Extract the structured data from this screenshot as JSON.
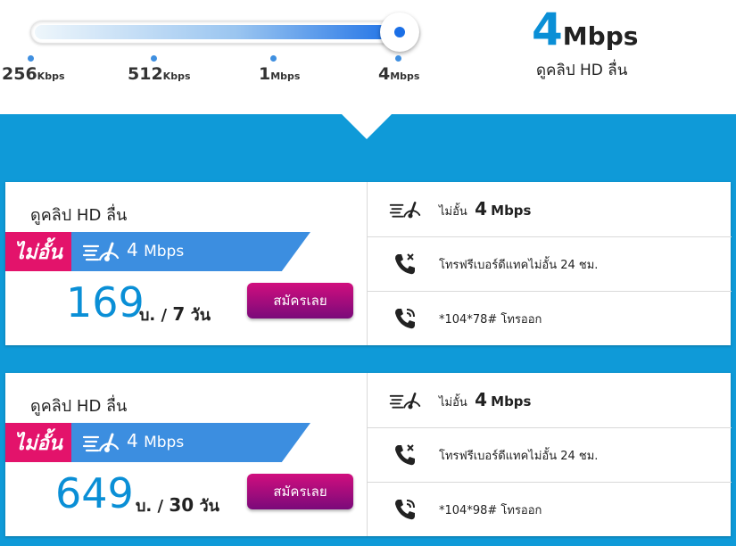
{
  "speed_selector": {
    "ticks": [
      {
        "value": "256",
        "unit": "Kbps"
      },
      {
        "value": "512",
        "unit": "Kbps"
      },
      {
        "value": "1",
        "unit": "Mbps"
      },
      {
        "value": "4",
        "unit": "Mbps"
      }
    ],
    "selected_index": 3,
    "slider_fraction": 1.0
  },
  "speed_readout": {
    "value": "4",
    "unit": "Mbps",
    "subtitle": "ดูคลิป HD ลื่น"
  },
  "plans": [
    {
      "title": "ดูคลิป HD ลื่น",
      "banner_tag": "ไม่อั้น",
      "banner_speed": "4",
      "banner_unit": "Mbps",
      "price": "169",
      "price_unit": "บ. /",
      "duration": "7",
      "duration_unit": "วัน",
      "button_label": "สมัครเลย",
      "features": {
        "speed_prefix": "ไม่อั้น",
        "speed_value": "4",
        "speed_unit": "Mbps",
        "call_text": "โทรฟรีเบอร์ดีแทคไม่อั้น 24 ชม.",
        "dial_code": "*104*78#",
        "dial_suffix": "โทรออก"
      }
    },
    {
      "title": "ดูคลิป HD ลื่น",
      "banner_tag": "ไม่อั้น",
      "banner_speed": "4",
      "banner_unit": "Mbps",
      "price": "649",
      "price_unit": "บ. /",
      "duration": "30",
      "duration_unit": "วัน",
      "button_label": "สมัครเลย",
      "features": {
        "speed_prefix": "ไม่อั้น",
        "speed_value": "4",
        "speed_unit": "Mbps",
        "call_text": "โทรฟรีเบอร์ดีแทคไม่อั้น 24 ชม.",
        "dial_code": "*104*98#",
        "dial_suffix": "โทรออก"
      }
    }
  ],
  "icons": {
    "speedometer": "speedometer-icon",
    "call_free": "phone-call-icon",
    "dial": "phone-ringing-icon"
  },
  "colors": {
    "brand_blue": "#0f9ad8",
    "accent_pink": "#e3136b",
    "banner_blue": "#3c8ee0",
    "button_start": "#d10e7e",
    "button_end": "#7a0a7a"
  }
}
